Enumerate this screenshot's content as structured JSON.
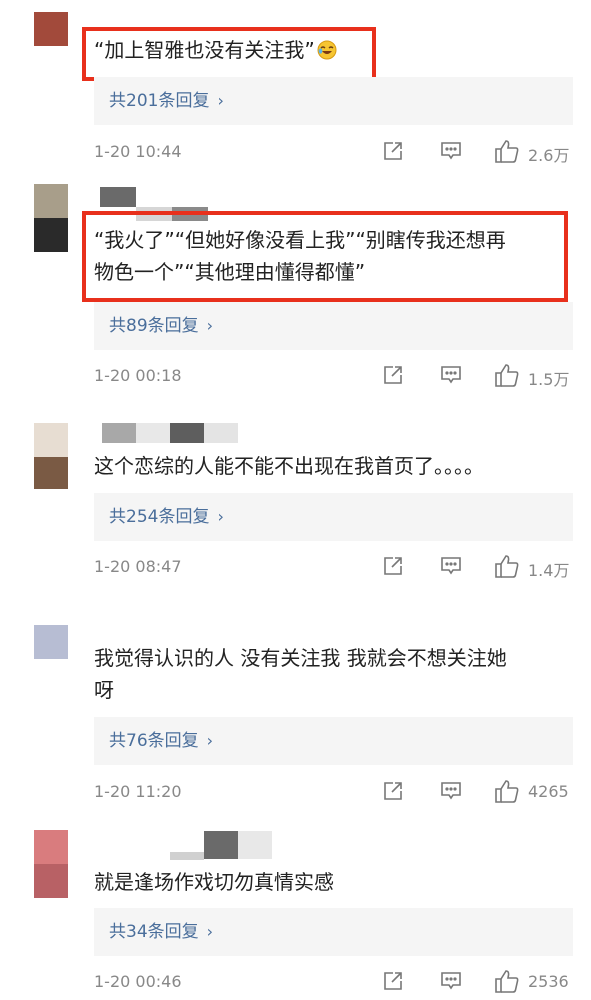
{
  "comments": [
    {
      "text_lines": [
        "“加上智雅也没有关注我”"
      ],
      "emoji": "laughing-tears-emoji",
      "replies_label": "共201条回复",
      "time": "1-20 10:44",
      "likes": "2.6万",
      "avatar_colors": [
        "#a24a3b"
      ]
    },
    {
      "text_lines": [
        "“我火了”“但她好像没看上我”“别瞎传我还想再",
        "物色一个”“其他理由懂得都懂”"
      ],
      "replies_label": "共89条回复",
      "time": "1-20 00:18",
      "likes": "1.5万",
      "avatar_colors": [
        "#a89e8a",
        "#2a2a2a"
      ]
    },
    {
      "text_lines": [
        "这个恋综的人能不能不出现在我首页了。。。。"
      ],
      "replies_label": "共254条回复",
      "time": "1-20 08:47",
      "likes": "1.4万",
      "avatar_colors": [
        "#e7ddd2",
        "#7a5a44"
      ]
    },
    {
      "text_lines": [
        "我觉得认识的人 没有关注我 我就会不想关注她",
        "呀"
      ],
      "replies_label": "共76条回复",
      "time": "1-20 11:20",
      "likes": "4265",
      "avatar_colors": [
        "#b7bdd3"
      ]
    },
    {
      "text_lines": [
        "就是逢场作戏切勿真情实感"
      ],
      "replies_label": "共34条回复",
      "time": "1-20 00:46",
      "likes": "2536",
      "avatar_colors": [
        "#d97c7e",
        "#b86165"
      ]
    }
  ],
  "icons": {
    "share": "share-icon",
    "comment": "comment-icon",
    "like": "thumbs-up-icon",
    "chevron": "chevron-right-icon"
  },
  "colors": {
    "highlight_border": "#e8301c",
    "reply_link": "#4a6e9b",
    "meta_text": "#888888",
    "reply_bg": "#f5f5f5"
  }
}
